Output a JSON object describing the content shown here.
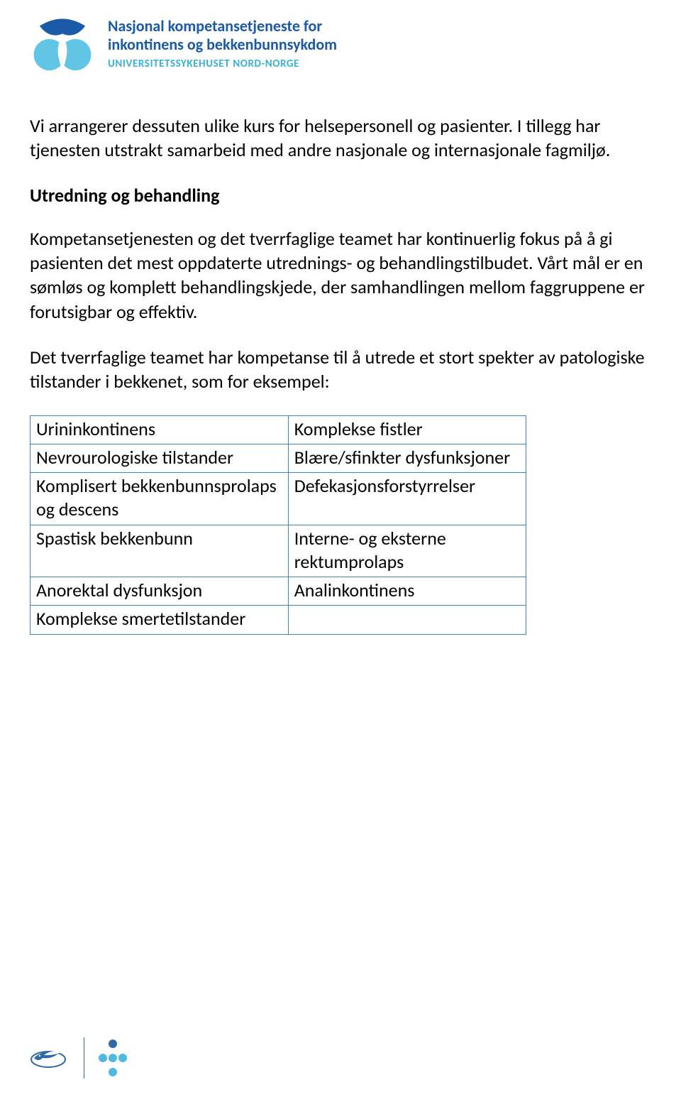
{
  "header": {
    "logo_title_line1": "Nasjonal kompetansetjeneste for",
    "logo_title_line2": "inkontinens og bekkenbunnsykdom",
    "logo_subtitle": "UNIVERSITETSSYKEHUSET NORD-NORGE"
  },
  "body": {
    "intro_paragraph": "Vi arrangerer dessuten ulike kurs for helsepersonell og pasienter. I tillegg har tjenesten utstrakt samarbeid med andre nasjonale og internasjonale fagmiljø.",
    "section_heading": "Utredning og behandling",
    "section_para1": "Kompetansetjenesten og det tverrfaglige teamet har kontinuerlig fokus på å gi pasienten det mest oppdaterte utrednings- og behandlingstilbudet. Vårt mål er en sømløs og komplett behandlingskjede, der samhandlingen mellom faggruppene er forutsigbar og effektiv.",
    "section_para2": "Det tverrfaglige teamet har kompetanse til å utrede et stort spekter av patologiske tilstander i bekkenet, som for eksempel:"
  },
  "table": {
    "rows": [
      {
        "left": "Urininkontinens",
        "right": "Komplekse fistler"
      },
      {
        "left": "Nevrourologiske tilstander",
        "right": "Blære/sfinkter dysfunksjoner"
      },
      {
        "left": "Komplisert bekkenbunnsprolaps og descens",
        "right": "Defekasjonsforstyrrelser"
      },
      {
        "left": "Spastisk bekkenbunn",
        "right": "Interne- og eksterne rektumprolaps"
      },
      {
        "left": "Anorektal dysfunksjon",
        "right": "Analinkontinens"
      },
      {
        "left": "Komplekse smertetilstander",
        "right": ""
      }
    ]
  },
  "colors": {
    "brand_blue": "#1b5aa8",
    "brand_cyan": "#39b1d6",
    "table_border": "#3b86c8"
  }
}
